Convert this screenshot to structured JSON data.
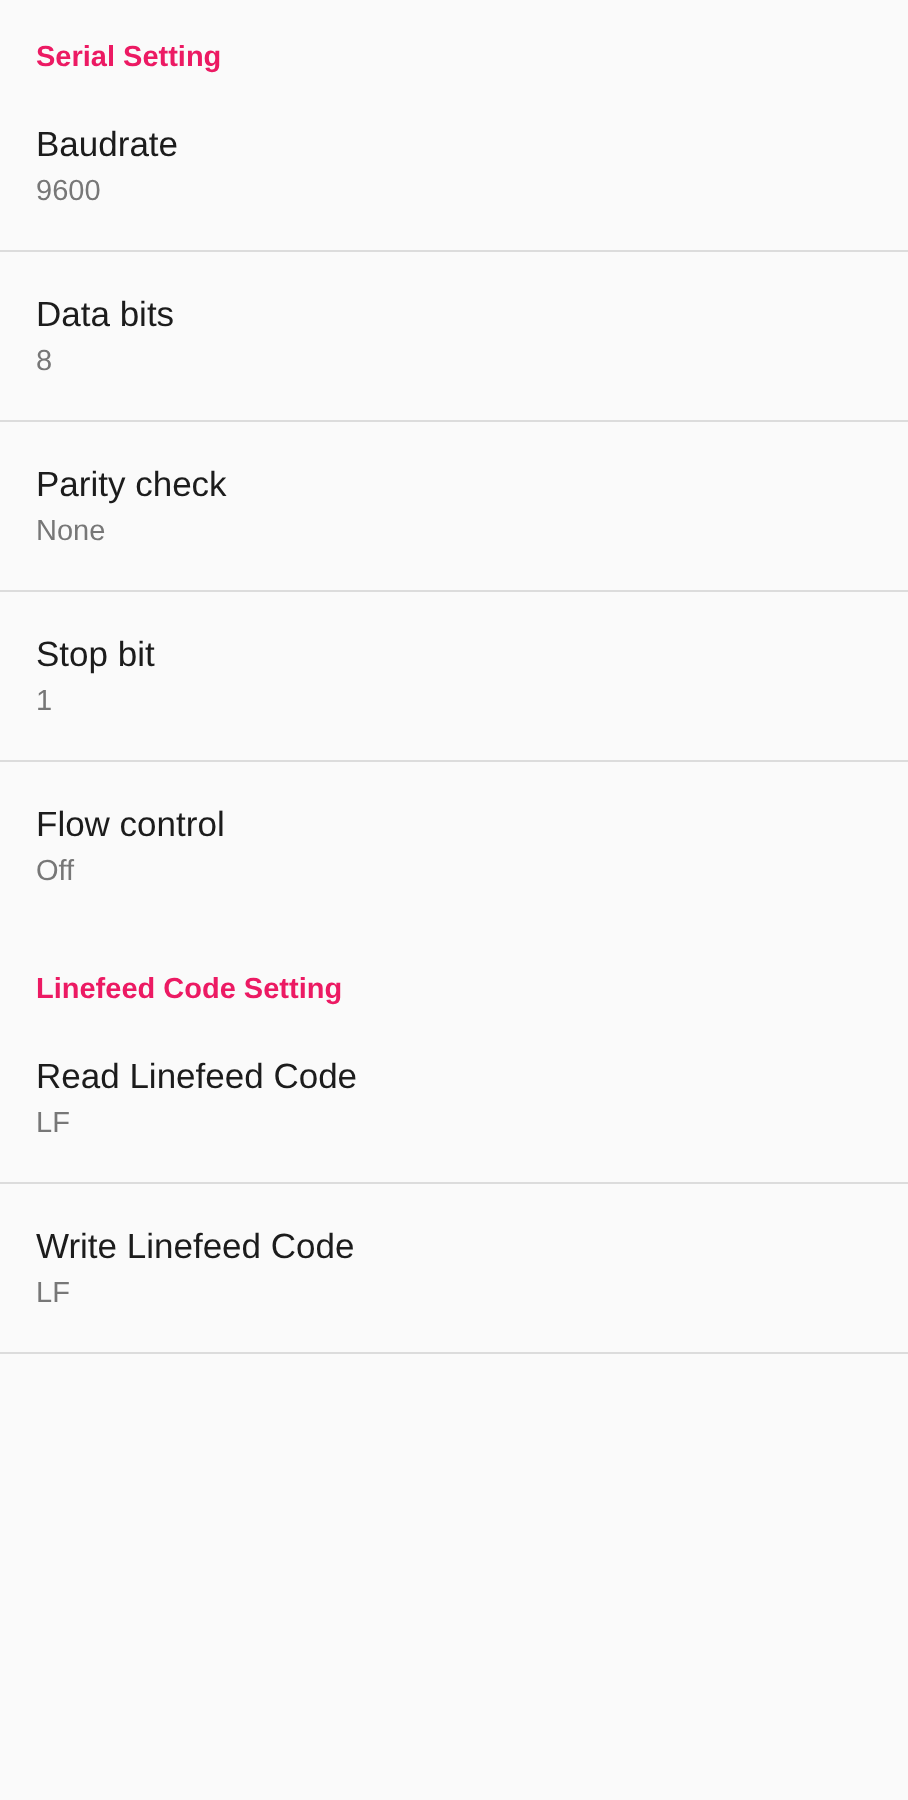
{
  "sections": [
    {
      "title": "Serial Setting",
      "items": [
        {
          "label": "Baudrate",
          "value": "9600"
        },
        {
          "label": "Data bits",
          "value": "8"
        },
        {
          "label": "Parity check",
          "value": "None"
        },
        {
          "label": "Stop bit",
          "value": "1"
        },
        {
          "label": "Flow control",
          "value": "Off"
        }
      ]
    },
    {
      "title": "Linefeed Code Setting",
      "items": [
        {
          "label": "Read Linefeed Code",
          "value": "LF"
        },
        {
          "label": "Write Linefeed Code",
          "value": "LF"
        }
      ]
    }
  ]
}
